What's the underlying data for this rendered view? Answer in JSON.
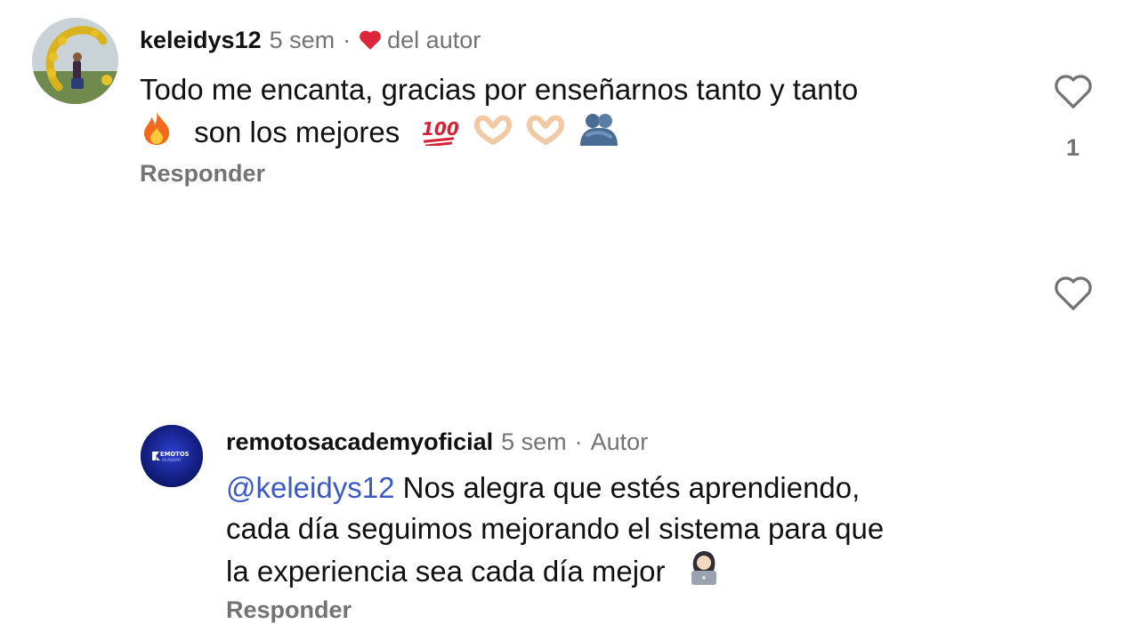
{
  "comments": [
    {
      "username": "keleidys12",
      "time": "5 sem",
      "tag": "del autor",
      "text_line1": "Todo me encanta, gracias por enseñarnos tanto y tanto",
      "text_line2": "son los mejores",
      "emojis": [
        "fire",
        "hundred-points",
        "heart-hands",
        "heart-hands",
        "people-hugging"
      ],
      "reply_label": "Responder",
      "like_count": "1"
    },
    {
      "username": "remotosacademyoficial",
      "time": "5 sem",
      "tag": "Autor",
      "mention": "@keleidys12",
      "text_first": " Nos alegra que estés aprendiendo,",
      "text_line2": "cada día seguimos mejorando el sistema para que",
      "text_line3": "la experiencia sea cada día mejor",
      "emojis": [
        "woman-technologist"
      ],
      "reply_label": "Responder",
      "avatar_logo_line1": "EMOTOS",
      "avatar_logo_line2": "ACADEMY"
    }
  ],
  "colors": {
    "secondary_text": "#737373",
    "mention": "#3b59c6",
    "author_heart": "#e0243a"
  }
}
